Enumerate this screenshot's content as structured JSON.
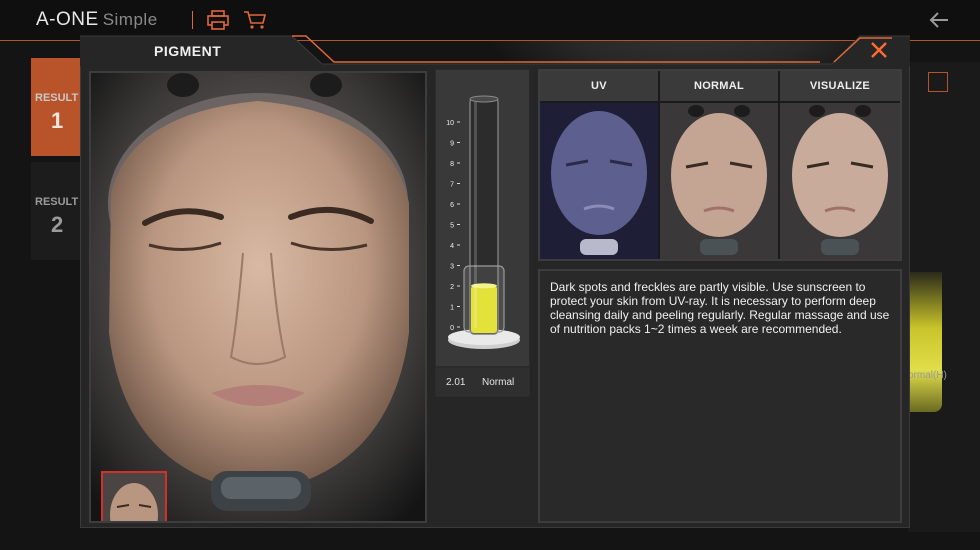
{
  "app": {
    "brand": "A-ONE",
    "brand_sub": "Simple",
    "icons": {
      "print": "printer-icon",
      "cart": "cart-icon",
      "back": "back-arrow-icon"
    }
  },
  "side_tabs": [
    {
      "label": "RESULT",
      "number": "1"
    },
    {
      "label": "RESULT",
      "number": "2"
    }
  ],
  "background_right": {
    "label": "ormal(H)"
  },
  "modal": {
    "title": "PIGMENT",
    "close_icon": "close-icon",
    "gauge": {
      "ticks": [
        "0",
        "1",
        "2",
        "3",
        "4",
        "5",
        "6",
        "7",
        "8",
        "9",
        "10"
      ],
      "max": 10,
      "value": 2.01,
      "value_label": "2.01",
      "status": "Normal"
    },
    "tabs": [
      {
        "label": "UV"
      },
      {
        "label": "NORMAL"
      },
      {
        "label": "VISUALIZE"
      }
    ],
    "description": "Dark spots and freckles are partly visible. Use sunscreen to protect your skin from UV-ray. It is necessary to perform deep cleansing daily and peeling regularly. Regular massage and use of nutrition packs 1~2 times a week are recommended.",
    "colors": {
      "accent": "#e2673a",
      "gauge_fill": "#e3e23a",
      "thumb_border": "#d0312d"
    }
  }
}
